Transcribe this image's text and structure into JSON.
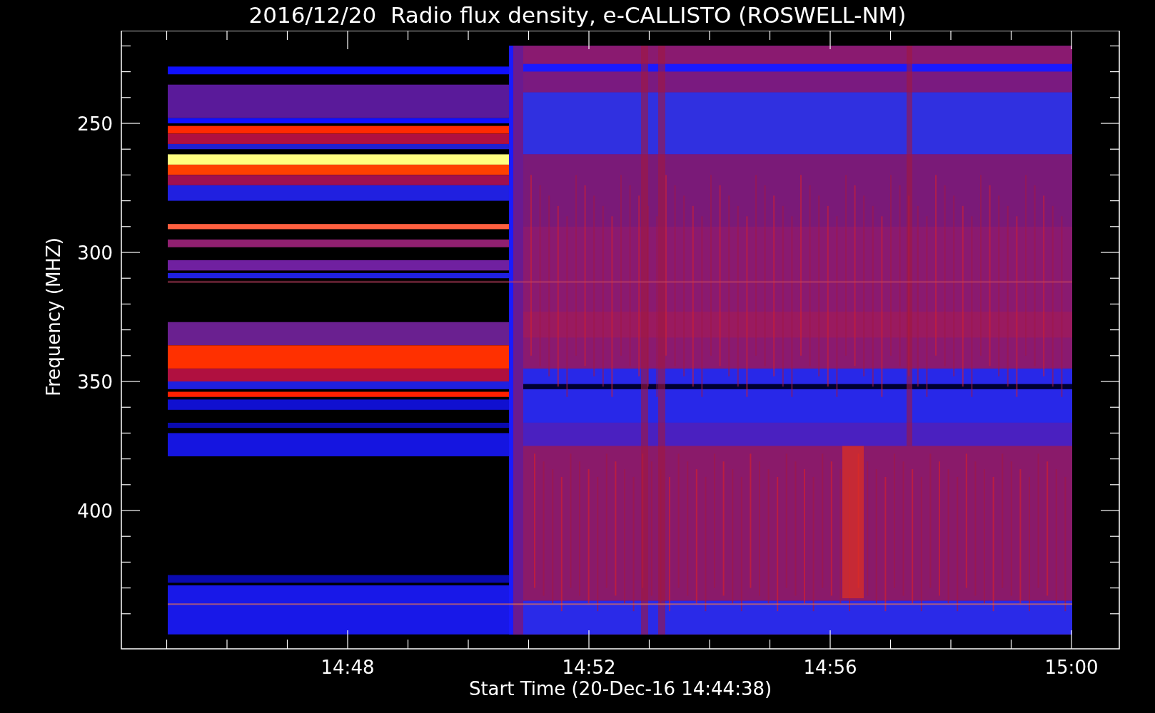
{
  "title": "2016/12/20  Radio flux density, e-CALLISTO (ROSWELL-NM)",
  "plot": {
    "kind": "spectrogram",
    "y_axis": {
      "label": "Frequency (MHZ)",
      "ticks": [
        "250",
        "300",
        "350",
        "400"
      ]
    },
    "x_axis": {
      "label": "Start Time (20-Dec-16 14:44:38)",
      "ticks": [
        "14:48",
        "14:52",
        "14:56",
        "15:00"
      ]
    }
  }
}
